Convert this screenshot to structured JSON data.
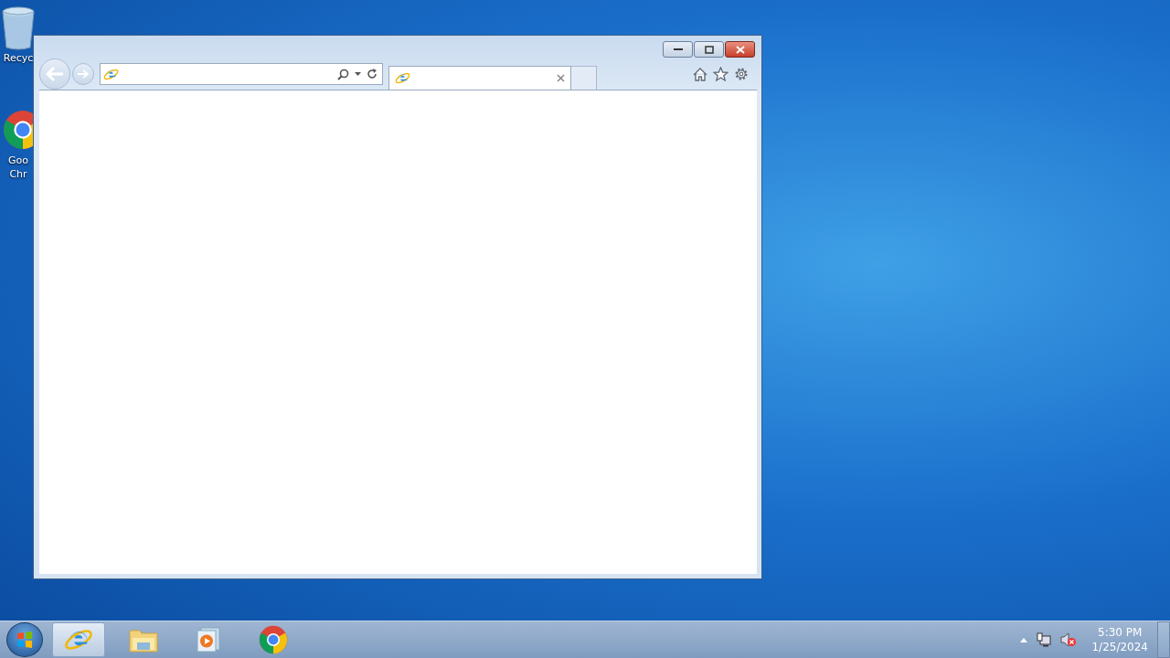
{
  "desktop": {
    "icons": [
      {
        "kind": "recycle-bin",
        "lines": [
          "Recyc"
        ]
      },
      {
        "kind": "chrome",
        "lines": [
          "Goo",
          "Chr"
        ]
      }
    ]
  },
  "browser": {
    "tabs": [
      {
        "selected": true
      }
    ]
  },
  "taskbar": {
    "items": [
      {
        "kind": "ie",
        "selected": true
      },
      {
        "kind": "explorer",
        "selected": false
      },
      {
        "kind": "media",
        "selected": false
      },
      {
        "kind": "chrome",
        "selected": false
      }
    ],
    "clock": {
      "time": "5:30 PM",
      "date": "1/25/2024"
    }
  }
}
